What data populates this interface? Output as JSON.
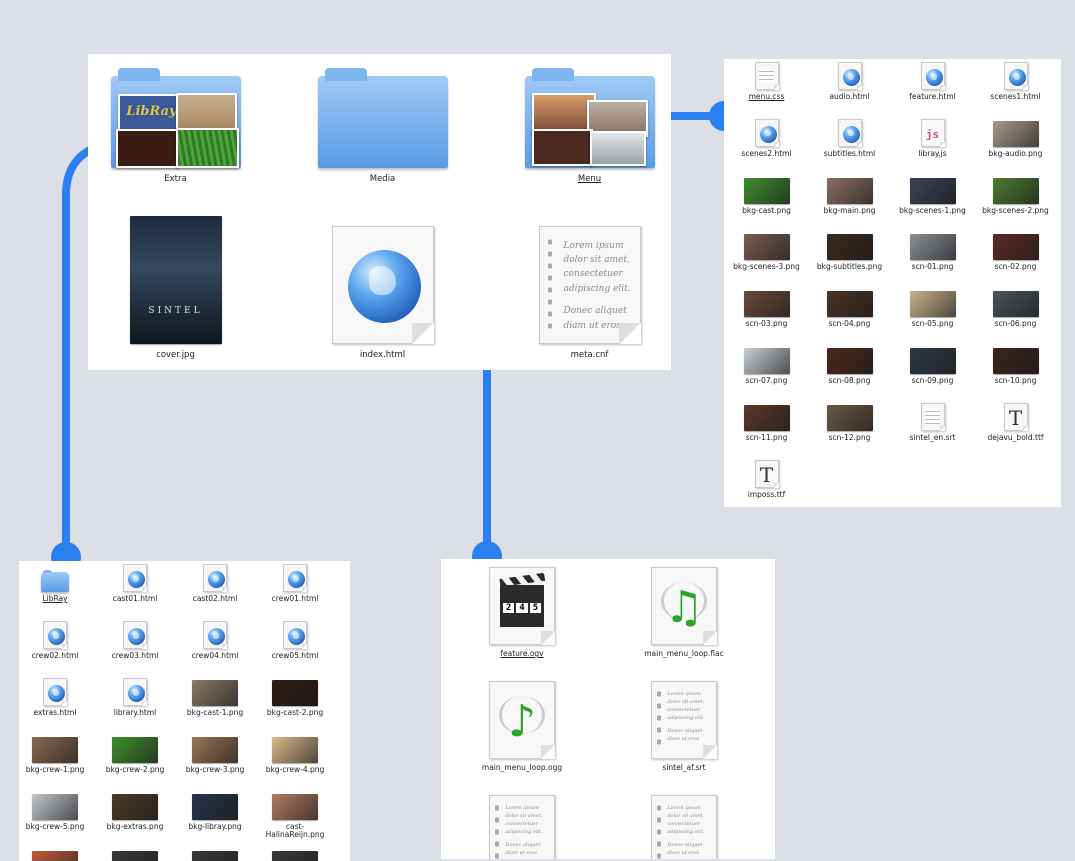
{
  "colors": {
    "background": "#dcdfe6",
    "panel": "#ffffff",
    "connector": "#2b7ff0",
    "folder": "#5a9be6"
  },
  "root": {
    "items": [
      {
        "name": "Extra",
        "icon": "folder-extra-icon"
      },
      {
        "name": "Media",
        "icon": "folder-icon"
      },
      {
        "name": "Menu",
        "icon": "folder-menu-icon"
      },
      {
        "name": "cover.jpg",
        "icon": "image-icon"
      },
      {
        "name": "index.html",
        "icon": "html-icon"
      },
      {
        "name": "meta.cnf",
        "icon": "text-file-icon"
      }
    ],
    "cover_poster_title": "SINTEL",
    "lorem_lines": [
      "Lorem ipsum",
      "dolor sit amet,",
      "consectetuer",
      "adipiscing elit.",
      "Donec aliquet",
      "diam ut eros"
    ],
    "libray_logo": "LibRay"
  },
  "menu_folder": {
    "items": [
      {
        "name": "menu.css",
        "icon": "text-file-icon"
      },
      {
        "name": "audio.html",
        "icon": "html-icon"
      },
      {
        "name": "feature.html",
        "icon": "html-icon"
      },
      {
        "name": "scenes1.html",
        "icon": "html-icon"
      },
      {
        "name": "scenes2.html",
        "icon": "html-icon"
      },
      {
        "name": "subtitles.html",
        "icon": "html-icon"
      },
      {
        "name": "libray.js",
        "icon": "js-icon",
        "glyph": "js"
      },
      {
        "name": "bkg-audio.png",
        "icon": "image-icon",
        "tone": "#a89a8c"
      },
      {
        "name": "bkg-cast.png",
        "icon": "image-icon",
        "tone": "#3f8f2e"
      },
      {
        "name": "bkg-main.png",
        "icon": "image-icon",
        "tone": "#8c6f63"
      },
      {
        "name": "bkg-scenes-1.png",
        "icon": "image-icon",
        "tone": "#3b4157"
      },
      {
        "name": "bkg-scenes-2.png",
        "icon": "image-icon",
        "tone": "#4e7a2f"
      },
      {
        "name": "bkg-scenes-3.png",
        "icon": "image-icon",
        "tone": "#7a5c52"
      },
      {
        "name": "bkg-subtitles.png",
        "icon": "image-icon",
        "tone": "#3d2a1e"
      },
      {
        "name": "scn-01.png",
        "icon": "image-icon",
        "tone": "#8b9096"
      },
      {
        "name": "scn-02.png",
        "icon": "image-icon",
        "tone": "#5a2b22"
      },
      {
        "name": "scn-03.png",
        "icon": "image-icon",
        "tone": "#6a4a3a"
      },
      {
        "name": "scn-04.png",
        "icon": "image-icon",
        "tone": "#4a3424"
      },
      {
        "name": "scn-05.png",
        "icon": "image-icon",
        "tone": "#c9b58a"
      },
      {
        "name": "scn-06.png",
        "icon": "image-icon",
        "tone": "#4c5358"
      },
      {
        "name": "scn-07.png",
        "icon": "image-icon",
        "tone": "#c9cfd4"
      },
      {
        "name": "scn-08.png",
        "icon": "image-icon",
        "tone": "#4a2a1a"
      },
      {
        "name": "scn-09.png",
        "icon": "image-icon",
        "tone": "#2f3a44"
      },
      {
        "name": "scn-10.png",
        "icon": "image-icon",
        "tone": "#3a2620"
      },
      {
        "name": "scn-11.png",
        "icon": "image-icon",
        "tone": "#5a3828"
      },
      {
        "name": "scn-12.png",
        "icon": "image-icon",
        "tone": "#6a5a44"
      },
      {
        "name": "sintel_en.srt",
        "icon": "text-file-icon"
      },
      {
        "name": "dejavu_bold.ttf",
        "icon": "font-icon",
        "glyph": "T"
      },
      {
        "name": "imposs.ttf",
        "icon": "font-icon",
        "glyph": "T"
      }
    ]
  },
  "extra_folder": {
    "items": [
      {
        "name": "LibRay",
        "icon": "folder-icon"
      },
      {
        "name": "cast01.html",
        "icon": "html-icon"
      },
      {
        "name": "cast02.html",
        "icon": "html-icon"
      },
      {
        "name": "crew01.html",
        "icon": "html-icon"
      },
      {
        "name": "crew02.html",
        "icon": "html-icon"
      },
      {
        "name": "crew03.html",
        "icon": "html-icon"
      },
      {
        "name": "crew04.html",
        "icon": "html-icon"
      },
      {
        "name": "crew05.html",
        "icon": "html-icon"
      },
      {
        "name": "extras.html",
        "icon": "html-icon"
      },
      {
        "name": "library.html",
        "icon": "html-icon"
      },
      {
        "name": "bkg-cast-1.png",
        "icon": "image-icon",
        "tone": "#8a7a66"
      },
      {
        "name": "bkg-cast-2.png",
        "icon": "image-icon",
        "tone": "#2e1a16"
      },
      {
        "name": "bkg-crew-1.png",
        "icon": "image-icon",
        "tone": "#8a6a52"
      },
      {
        "name": "bkg-crew-2.png",
        "icon": "image-icon",
        "tone": "#3f8f2e"
      },
      {
        "name": "bkg-crew-3.png",
        "icon": "image-icon",
        "tone": "#9a7556"
      },
      {
        "name": "bkg-crew-4.png",
        "icon": "image-icon",
        "tone": "#d9b98a"
      },
      {
        "name": "bkg-crew-5.png",
        "icon": "image-icon",
        "tone": "#c2c6cc"
      },
      {
        "name": "bkg-extras.png",
        "icon": "image-icon",
        "tone": "#4a3a28"
      },
      {
        "name": "bkg-libray.png",
        "icon": "image-icon",
        "tone": "#283448"
      },
      {
        "name": "cast-HalinaReijn.png",
        "icon": "image-icon",
        "tone": "#b07b64"
      },
      {
        "name": "",
        "icon": "image-icon",
        "tone": "#c05a3a"
      },
      {
        "name": "",
        "icon": "image-icon",
        "tone": "#3a3a3a"
      },
      {
        "name": "",
        "icon": "image-icon",
        "tone": "#3a3a3a"
      },
      {
        "name": "",
        "icon": "image-icon",
        "tone": "#3a3a3a"
      }
    ]
  },
  "media_folder": {
    "items": [
      {
        "name": "feature.ogv",
        "icon": "video-icon"
      },
      {
        "name": "main_menu_loop.flac",
        "icon": "audio-icon"
      },
      {
        "name": "main_menu_loop.ogg",
        "icon": "audio-icon"
      },
      {
        "name": "sintel_af.srt",
        "icon": "text-file-icon"
      },
      {
        "name": "",
        "icon": "text-file-icon"
      },
      {
        "name": "",
        "icon": "text-file-icon"
      }
    ],
    "clapper_digits": [
      "2",
      "4",
      "5"
    ],
    "note_glyph": "♫",
    "note_glyph_single": "♪"
  }
}
